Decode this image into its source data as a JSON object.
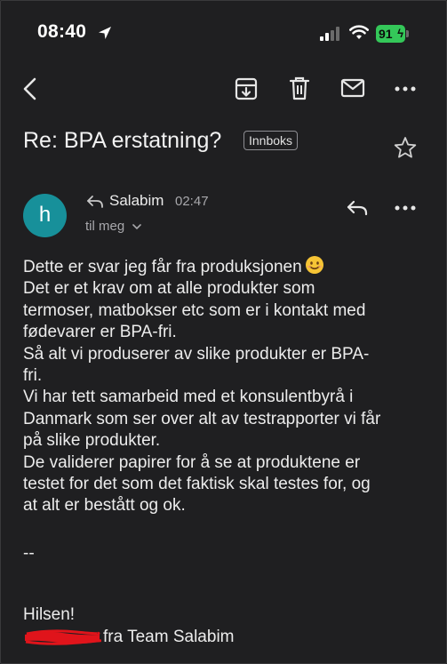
{
  "status_bar": {
    "time": "08:40",
    "battery": "91"
  },
  "header": {
    "subject": "Re: BPA erstatning?",
    "label_badge": "Innboks"
  },
  "message": {
    "avatar_initial": "h",
    "sender": "Salabim",
    "time": "02:47",
    "recipient": "til meg",
    "body_lines": [
      "Dette er svar jeg får fra produksjonen",
      "Det er et krav om at alle produkter som",
      "termoser, matbokser etc som er i kontakt med",
      "fødevarer er BPA-fri.",
      "Så alt vi produserer av slike produkter er BPA-",
      "fri.",
      "Vi har tett samarbeid med et konsulentbyrå i",
      "Danmark som ser over alt av testrapporter vi får",
      "på slike produkter.",
      "De validerer papirer for å se at produktene er",
      "testet for det som det faktisk skal testes for, og",
      "at alt er bestått og ok."
    ],
    "signature_separator": "--",
    "greeting": "Hilsen!",
    "team_line": "fra Team Salabim"
  },
  "colors": {
    "background": "#1f1f21",
    "avatar": "#17909a",
    "battery": "#34c759",
    "redaction": "#e0141b"
  },
  "icons": [
    "back-chevron-icon",
    "archive-icon",
    "trash-icon",
    "mail-icon",
    "more-icon",
    "star-icon",
    "reply-icon",
    "chevron-down-icon",
    "smiley-emoji-icon"
  ]
}
